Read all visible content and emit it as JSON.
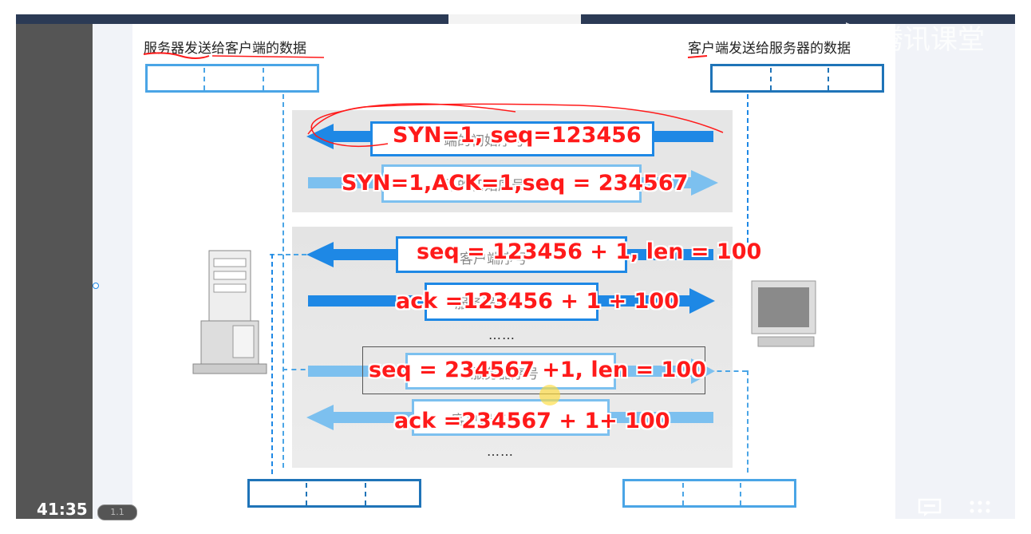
{
  "player": {
    "timecode": "41:35",
    "speed": "1.1",
    "brand": "腾讯课堂",
    "controls": [
      "list-icon",
      "comment-icon",
      "grid-icon"
    ]
  },
  "slide": {
    "left_title": "服务器发送给客户端的数据",
    "right_title": "客户端发送给服务器的数据",
    "faint_labels": [
      "端的初始序号",
      "器的初始序号",
      "客户端序号",
      "服务器序号",
      "服务器序号",
      "客户端序号"
    ],
    "ellipsis": "……",
    "annotations": [
      "SYN=1, seq=123456",
      "SYN=1,ACK=1,seq = 234567",
      "seq = 123456 + 1, len = 100",
      "ack =123456 + 1 + 100",
      "seq = 234567 +1, len = 100",
      "ack =234567 + 1+ 100"
    ]
  },
  "colors": {
    "accent": "#1e88e5",
    "light_accent": "#7cc0ef",
    "annotation": "#ff1a1a",
    "panel": "#e6e6e6"
  }
}
